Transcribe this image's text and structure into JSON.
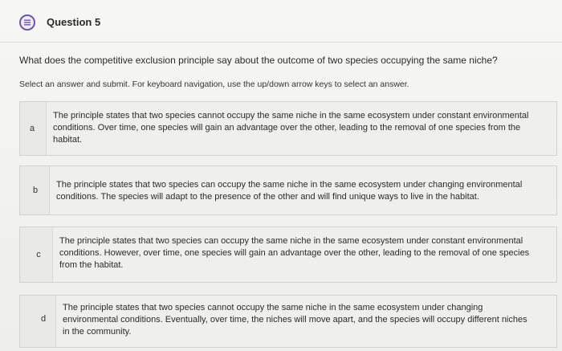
{
  "question": {
    "title": "Question 5",
    "prompt": "What does the competitive exclusion principle say about the outcome of two species occupying the same niche?",
    "instructions": "Select an answer and submit. For keyboard navigation, use the up/down arrow keys to select an answer."
  },
  "options": [
    {
      "letter": "a",
      "lines": [
        "The principle states that two species cannot occupy the same niche in the same ecosystem under constant environmental",
        "conditions. Over time, one species will gain an advantage over the other, leading to the removal of one species from the",
        "habitat."
      ]
    },
    {
      "letter": "b",
      "lines": [
        "The principle states that two species can occupy the same niche in the same ecosystem under changing environmental",
        "conditions. The species will adapt to the presence of the other and will find unique ways to live in the habitat."
      ]
    },
    {
      "letter": "c",
      "lines": [
        "The principle states that two species can occupy the same niche in the same ecosystem under constant environmental",
        "conditions. However, over time, one species will gain an advantage over the other, leading to the removal of one species",
        "from the habitat."
      ]
    },
    {
      "letter": "d",
      "lines": [
        "The principle states that two species cannot occupy the same niche in the same ecosystem under changing",
        "environmental conditions. Eventually, over time, the niches will move apart, and the species will occupy different niches",
        "in the community."
      ]
    }
  ],
  "colors": {
    "icon_accent": "#6f55a8",
    "option_bg": "#efefed"
  },
  "icons": {
    "question": "question-list-icon"
  }
}
